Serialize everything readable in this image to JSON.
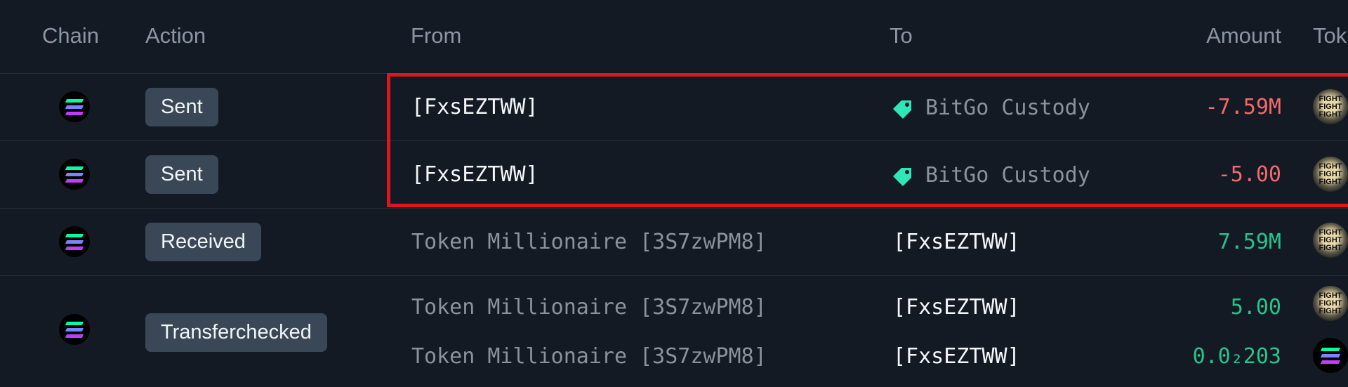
{
  "columns": {
    "chain": "Chain",
    "action": "Action",
    "from": "From",
    "to": "To",
    "amount": "Amount",
    "token": "Tok"
  },
  "rows": [
    {
      "chain_icon": "solana-icon",
      "action": "Sent",
      "from": "[FxsEZTWW]",
      "to": "BitGo Custody",
      "to_icon": "tag-icon",
      "amount": "-7.59M",
      "token_icon": "fight-token-icon"
    },
    {
      "chain_icon": "solana-icon",
      "action": "Sent",
      "from": "[FxsEZTWW]",
      "to": "BitGo Custody",
      "to_icon": "tag-icon",
      "amount": "-5.00",
      "token_icon": "fight-token-icon"
    },
    {
      "chain_icon": "solana-icon",
      "action": "Received",
      "from": "Token Millionaire [3S7zwPM8]",
      "to": "[FxsEZTWW]",
      "amount": "7.59M",
      "token_icon": "fight-token-icon"
    },
    {
      "chain_icon": "solana-icon",
      "action": "Transferchecked",
      "transfers": [
        {
          "from": "Token Millionaire [3S7zwPM8]",
          "to": "[FxsEZTWW]",
          "amount": "5.00",
          "token_icon": "fight-token-icon"
        },
        {
          "from": "Token Millionaire [3S7zwPM8]",
          "to": "[FxsEZTWW]",
          "amount": "0.0₂203",
          "token_icon": "solana-token-icon"
        }
      ]
    }
  ],
  "token_logo_text": [
    "FIGHT",
    "FIGHT",
    "FIGHT"
  ],
  "colors": {
    "background": "#131a24",
    "negative": "#f26a6a",
    "positive": "#27c48a",
    "tag": "#2ee6b8",
    "highlight": "#e0141b"
  }
}
